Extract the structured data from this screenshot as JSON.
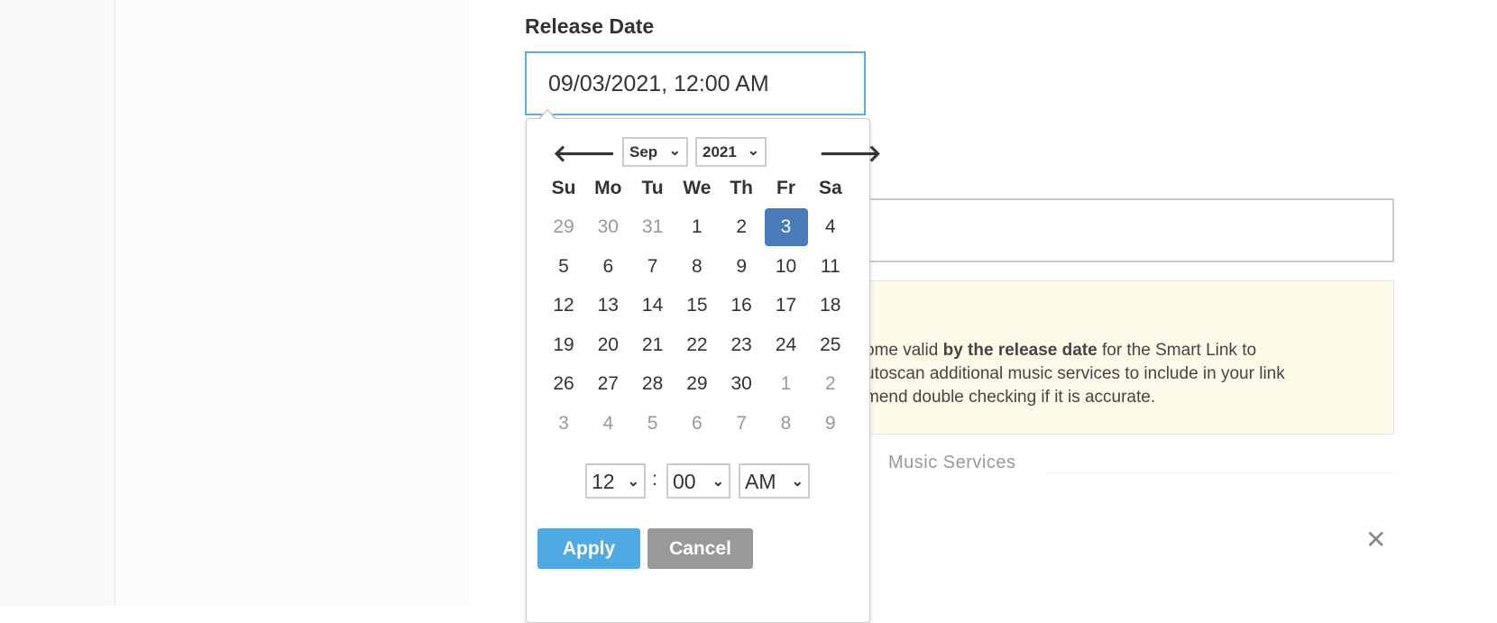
{
  "field": {
    "label": "Release Date",
    "value": "09/03/2021, 12:00 AM"
  },
  "warning": {
    "lines": [
      [
        "ome valid ",
        "by the release date",
        " for the Smart Link to"
      ],
      "utoscan additional music services to include in your link",
      "mend double checking if it is accurate."
    ]
  },
  "music_services": "Music Services",
  "close_icon": "✕",
  "datepicker": {
    "prev_icon": "arrow-left",
    "next_icon": "arrow-right",
    "month": "Sep",
    "year": "2021",
    "weekdays": [
      "Su",
      "Mo",
      "Tu",
      "We",
      "Th",
      "Fr",
      "Sa"
    ],
    "weeks": [
      [
        "29",
        "30",
        "31",
        "1",
        "2",
        "3",
        "4"
      ],
      [
        "5",
        "6",
        "7",
        "8",
        "9",
        "10",
        "11"
      ],
      [
        "12",
        "13",
        "14",
        "15",
        "16",
        "17",
        "18"
      ],
      [
        "19",
        "20",
        "21",
        "22",
        "23",
        "24",
        "25"
      ],
      [
        "26",
        "27",
        "28",
        "29",
        "30",
        "1",
        "2"
      ],
      [
        "3",
        "4",
        "5",
        "6",
        "7",
        "8",
        "9"
      ]
    ],
    "selected": "3",
    "hour": "12",
    "minute": "00",
    "ampm": "AM",
    "apply_label": "Apply",
    "cancel_label": "Cancel"
  },
  "colors": {
    "accent": "#5aaee3",
    "selected": "#4a7ab8",
    "apply": "#4fa9e3",
    "cancel": "#999999",
    "warning_bg": "#fefaea"
  }
}
